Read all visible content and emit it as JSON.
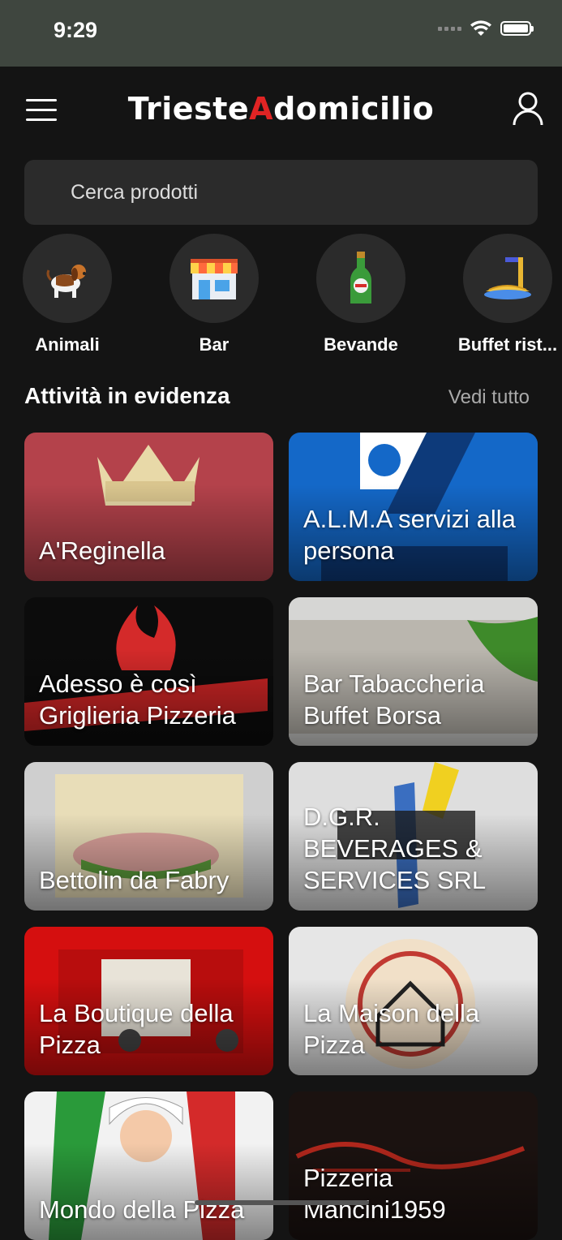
{
  "status": {
    "time": "9:29"
  },
  "header": {
    "logo_main": "Trieste",
    "logo_accent": "A",
    "logo_end": "domicilio"
  },
  "search": {
    "placeholder": "Cerca prodotti"
  },
  "categories": [
    {
      "label": "Animali",
      "icon": "dog-icon"
    },
    {
      "label": "Bar",
      "icon": "shop-icon"
    },
    {
      "label": "Bevande",
      "icon": "bottle-icon"
    },
    {
      "label": "Buffet rist...",
      "icon": "food-icon"
    }
  ],
  "featured": {
    "title": "Attività in evidenza",
    "see_all": "Vedi tutto",
    "items": [
      {
        "name": "A'Reginella"
      },
      {
        "name": "A.L.M.A servizi alla persona"
      },
      {
        "name": "Adesso è così Griglieria Pizzeria"
      },
      {
        "name": "Bar Tabaccheria Buffet Borsa"
      },
      {
        "name": "Bettolin da Fabry"
      },
      {
        "name": "D.G.R. BEVERAGES & SERVICES SRL"
      },
      {
        "name": "La Boutique della Pizza"
      },
      {
        "name": "La Maison della Pizza"
      },
      {
        "name": "Mondo della Pizza"
      },
      {
        "name": "Pizzeria Mancini1959"
      }
    ]
  },
  "colors": {
    "background": "#141414",
    "accent": "#e02424",
    "surface": "#2b2b2b"
  }
}
